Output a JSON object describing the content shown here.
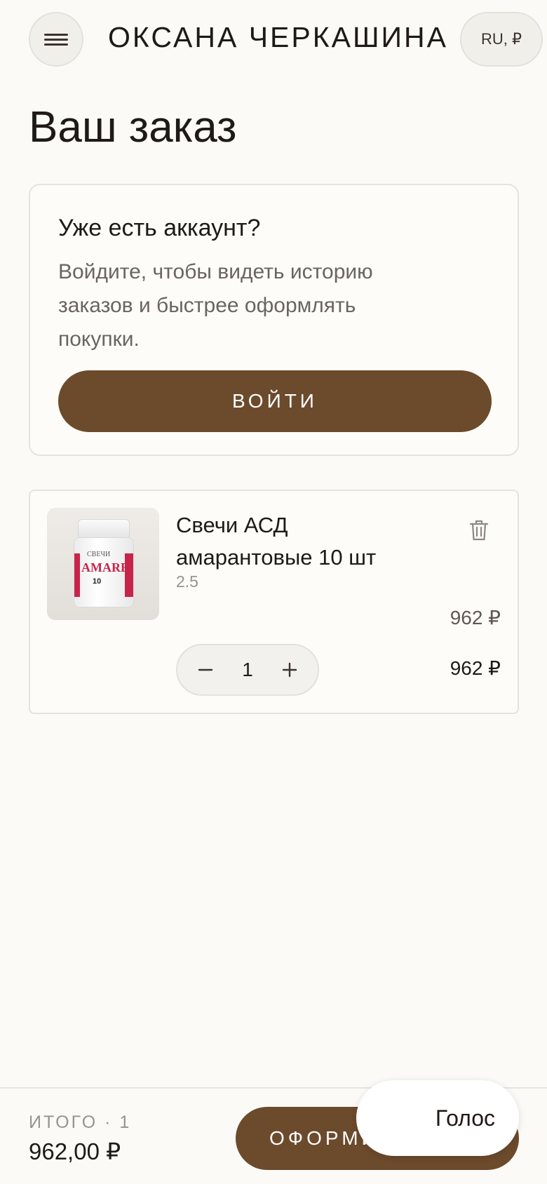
{
  "header": {
    "brand": "ОКСАНА ЧЕРКАШИНА",
    "locale": "RU, ₽"
  },
  "page_title": "Ваш заказ",
  "login_card": {
    "title": "Уже есть аккаунт?",
    "description": "Войдите, чтобы видеть историю заказов и быстрее оформлять покупки.",
    "button": "ВОЙТИ"
  },
  "cart": {
    "items": [
      {
        "name": "Свечи АСД амарантовые 10 шт",
        "variant": "2.5",
        "unit_price": "962 ₽",
        "quantity": "1",
        "total": "962 ₽",
        "image": {
          "label_small": "СВЕЧИ",
          "label_brand": "AMARE",
          "label_count": "10"
        }
      }
    ]
  },
  "footer": {
    "total_label": "ИТОГО · 1",
    "total_value": "962,00 ₽",
    "checkout": "ОФОРМИТЬ",
    "voice": "Голос"
  },
  "colors": {
    "accent": "#6c4a2c",
    "background": "#fbfaf7",
    "label_red": "#c8234a"
  }
}
